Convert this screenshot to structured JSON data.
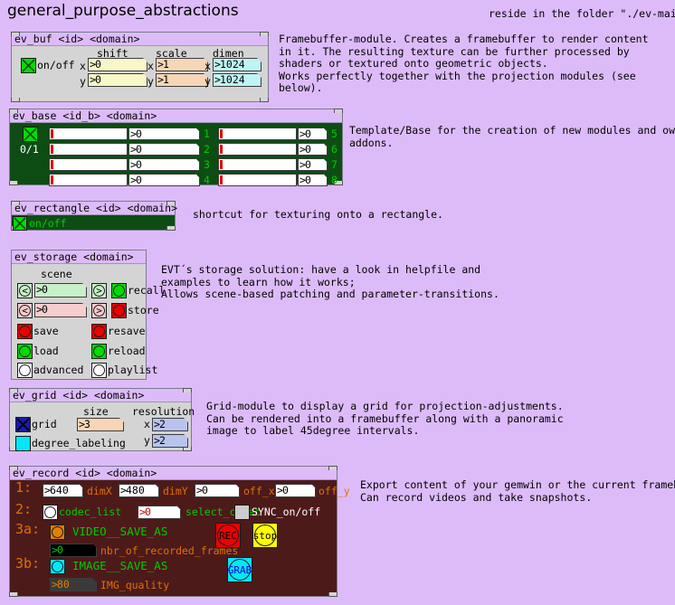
{
  "page": {
    "title": "general_purpose_abstractions",
    "top_right_note": "reside in the folder \"./ev-main\""
  },
  "colors": {
    "canvas_bg": "#ddbbf9",
    "module_bg": "#d4d4d4",
    "base_bg": "#0d4d14",
    "rectangle_bg": "#0d4d14",
    "record_bg": "#4d1a1a",
    "green": "#00cc00",
    "red": "#ee0000",
    "cyan": "#00e8f8",
    "yellow": "#ffff00",
    "orange": "#f08000"
  },
  "modules": [
    {
      "id": "ev_buf",
      "header": "ev_buf <id> <domain>",
      "comment": "Framebuffer-module. Creates a framebuffer to render content\nin it. The resulting texture can be further processed by\nshaders or textured onto geometric objects.\nWorks perfectly together with the projection modules (see\nbelow).",
      "toggle_label": "on/off",
      "toggle_state": "on",
      "columns": [
        {
          "title": "shift",
          "rows": [
            {
              "axis": "x",
              "value": "0"
            },
            {
              "axis": "y",
              "value": "0"
            }
          ]
        },
        {
          "title": "scale",
          "rows": [
            {
              "axis": "x",
              "value": "1"
            },
            {
              "axis": "y",
              "value": "1"
            }
          ]
        },
        {
          "title": "dimen",
          "rows": [
            {
              "axis": "x",
              "value": "1024"
            },
            {
              "axis": "y",
              "value": "1024"
            }
          ]
        }
      ]
    },
    {
      "id": "ev_base",
      "header": "ev_base <id_b> <domain>",
      "comment": "Template/Base for the creation of new modules and own\naddons.",
      "toggle_label": "0/1",
      "toggle_state": "on",
      "channels": [
        {
          "index": "1",
          "slider": 0,
          "value": "0"
        },
        {
          "index": "2",
          "slider": 0,
          "value": "0"
        },
        {
          "index": "3",
          "slider": 0,
          "value": "0"
        },
        {
          "index": "4",
          "slider": 0,
          "value": "0"
        },
        {
          "index": "5",
          "slider": 0,
          "value": "0"
        },
        {
          "index": "6",
          "slider": 0,
          "value": "0"
        },
        {
          "index": "7",
          "slider": 0,
          "value": "0"
        },
        {
          "index": "8",
          "slider": 0,
          "value": "0"
        }
      ]
    },
    {
      "id": "ev_rectangle",
      "header": "ev_rectangle <id> <domain>",
      "comment": "shortcut for texturing onto a rectangle.",
      "toggle_label": "on/off",
      "toggle_state": "on"
    },
    {
      "id": "ev_storage",
      "header": "ev_storage <domain>",
      "comment": "EVT´s storage solution: have a look in helpfile and\nexamples to learn how it works;\nAllows scene-based patching and parameter-transitions.",
      "scene_label": "scene",
      "rows": [
        {
          "prev": "<",
          "value": "0",
          "next": ">",
          "action": "recall",
          "action_color": "#00dd00",
          "tint": "#c8f0c8"
        },
        {
          "prev": "<",
          "value": "0",
          "next": ">",
          "action": "store",
          "action_color": "#ee0000",
          "tint": "#f6cccc"
        }
      ],
      "buttons": [
        {
          "label": "save",
          "color": "#ee0000"
        },
        {
          "label": "resave",
          "color": "#ee0000"
        },
        {
          "label": "load",
          "color": "#00dd00"
        },
        {
          "label": "reload",
          "color": "#00dd00"
        },
        {
          "label": "advanced",
          "color": "#ffffff"
        },
        {
          "label": "playlist",
          "color": "#ffffff"
        }
      ]
    },
    {
      "id": "ev_grid",
      "header": "ev_grid <id> <domain>",
      "comment": "Grid-module to display a grid for projection-adjustments.\nCan be rendered into a framebuffer along with a panoramic\nimage to label 45degree intervals.",
      "toggles": [
        {
          "label": "grid",
          "color": "#1a1aa8",
          "state": "on"
        },
        {
          "label": "degree_labeling",
          "color": "#00e8f8",
          "state": "off"
        }
      ],
      "size": {
        "title": "size",
        "value": "3"
      },
      "resolution": {
        "title": "resolution",
        "x": "2",
        "y": "2"
      }
    },
    {
      "id": "ev_record",
      "header": "ev_record <id> <domain>",
      "comment": "Export content of your gemwin or the current framebuffer.\nCan record videos and take snapshots.",
      "row1": {
        "tag": "1:",
        "fields": [
          {
            "value": "640",
            "label": "dimX"
          },
          {
            "value": "480",
            "label": "dimY"
          },
          {
            "value": "0",
            "label": "off_x"
          },
          {
            "value": "0",
            "label": "off_y"
          }
        ]
      },
      "row2": {
        "tag": "2:",
        "codec_bang_label": "codec_list",
        "select_codec_value": "0",
        "select_codec_label": "select_codec",
        "sync_label": "SYNC_on/off",
        "sync_state": "off"
      },
      "row3a": {
        "tag": "3a:",
        "bang_color": "#e08000",
        "label": "VIDEO__SAVE_AS",
        "frames_value": "0",
        "frames_label": "nbr_of_recorded_frames",
        "rec_label": "REC",
        "stop_label": "stop"
      },
      "row3b": {
        "tag": "3b:",
        "bang_color": "#00e8f8",
        "label": "IMAGE__SAVE_AS",
        "quality_value": "80",
        "quality_label": "IMG_quality",
        "grab_label": "GRAB"
      }
    }
  ]
}
